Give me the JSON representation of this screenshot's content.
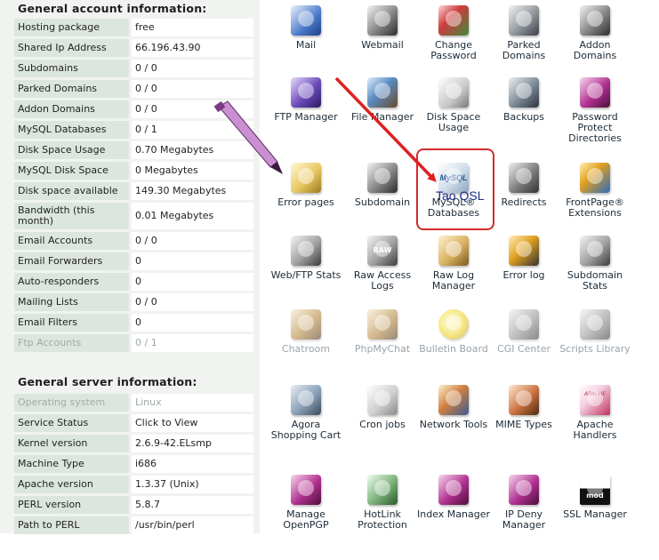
{
  "account_section": {
    "title": "General account information:",
    "rows": [
      {
        "label": "Hosting package",
        "value": "free"
      },
      {
        "label": "Shared Ip Address",
        "value": "66.196.43.90"
      },
      {
        "label": "Subdomains",
        "value": "0 / 0"
      },
      {
        "label": "Parked Domains",
        "value": "0 / 0"
      },
      {
        "label": "Addon Domains",
        "value": "0 / 0"
      },
      {
        "label": "MySQL Databases",
        "value": "0 / 1"
      },
      {
        "label": "Disk Space Usage",
        "value": "0.70 Megabytes"
      },
      {
        "label": "MySQL Disk Space",
        "value": "0 Megabytes"
      },
      {
        "label": "Disk space available",
        "value": "149.30 Megabytes"
      },
      {
        "label": "Bandwidth (this month)",
        "value": "0.01 Megabytes"
      },
      {
        "label": "Email Accounts",
        "value": "0 / 0"
      },
      {
        "label": "Email Forwarders",
        "value": "0"
      },
      {
        "label": "Auto-responders",
        "value": "0"
      },
      {
        "label": "Mailing Lists",
        "value": "0 / 0"
      },
      {
        "label": "Email Filters",
        "value": "0"
      },
      {
        "label": "Ftp Accounts",
        "value": "0 / 1"
      }
    ]
  },
  "server_section": {
    "title": "General server information:",
    "rows": [
      {
        "label": "Operating system",
        "value": "Linux"
      },
      {
        "label": "Service Status",
        "value": "Click to View"
      },
      {
        "label": "Kernel version",
        "value": "2.6.9-42.ELsmp"
      },
      {
        "label": "Machine Type",
        "value": "i686"
      },
      {
        "label": "Apache version",
        "value": "1.3.37 (Unix)"
      },
      {
        "label": "PERL version",
        "value": "5.8.7"
      },
      {
        "label": "Path to PERL",
        "value": "/usr/bin/perl"
      }
    ]
  },
  "icons": [
    {
      "label": "Mail",
      "icon": "mail-icon"
    },
    {
      "label": "Webmail",
      "icon": "webmail-icon"
    },
    {
      "label": "Change Password",
      "icon": "change-password-icon"
    },
    {
      "label": "Parked Domains",
      "icon": "parked-domains-icon"
    },
    {
      "label": "Addon Domains",
      "icon": "addon-domains-icon"
    },
    {
      "label": "FTP Manager",
      "icon": "ftp-manager-icon"
    },
    {
      "label": "File Manager",
      "icon": "file-manager-icon"
    },
    {
      "label": "Disk Space Usage",
      "icon": "disk-space-icon"
    },
    {
      "label": "Backups",
      "icon": "backups-icon"
    },
    {
      "label": "Password Protect Directories",
      "icon": "password-protect-icon"
    },
    {
      "label": "Error pages",
      "icon": "error-pages-icon"
    },
    {
      "label": "Subdomain",
      "icon": "subdomain-icon"
    },
    {
      "label": "MySQL® Databases",
      "icon": "mysql-icon"
    },
    {
      "label": "Redirects",
      "icon": "redirects-icon"
    },
    {
      "label": "FrontPage® Extensions",
      "icon": "frontpage-icon"
    },
    {
      "label": "Web/FTP Stats",
      "icon": "web-ftp-stats-icon"
    },
    {
      "label": "Raw Access Logs",
      "icon": "raw-access-logs-icon"
    },
    {
      "label": "Raw Log Manager",
      "icon": "raw-log-manager-icon"
    },
    {
      "label": "Error log",
      "icon": "error-log-icon"
    },
    {
      "label": "Subdomain Stats",
      "icon": "subdomain-stats-icon"
    },
    {
      "label": "Chatroom",
      "icon": "chatroom-icon"
    },
    {
      "label": "PhpMyChat",
      "icon": "phpmychat-icon"
    },
    {
      "label": "Bulletin Board",
      "icon": "bulletin-board-icon"
    },
    {
      "label": "CGI Center",
      "icon": "cgi-center-icon"
    },
    {
      "label": "Scripts Library",
      "icon": "scripts-library-icon"
    },
    {
      "label": "Agora Shopping Cart",
      "icon": "shopping-cart-icon"
    },
    {
      "label": "Cron jobs",
      "icon": "cron-jobs-icon"
    },
    {
      "label": "Network Tools",
      "icon": "network-tools-icon"
    },
    {
      "label": "MIME Types",
      "icon": "mime-types-icon"
    },
    {
      "label": "Apache Handlers",
      "icon": "apache-handlers-icon"
    },
    {
      "label": "Manage OpenPGP",
      "icon": "openpgp-icon"
    },
    {
      "label": "HotLink Protection",
      "icon": "hotlink-icon"
    },
    {
      "label": "Index Manager",
      "icon": "index-manager-icon"
    },
    {
      "label": "IP Deny Manager",
      "icon": "ip-deny-icon"
    },
    {
      "label": "SSL Manager",
      "icon": "ssl-manager-icon"
    }
  ],
  "icon_art": {
    "mysql_logo": "MySQL",
    "raw_badge": "RAW",
    "apache_logo": "APACHE",
    "ssl_logo": "mod SSL"
  },
  "annotation": {
    "callout_text": "Tao QSL",
    "arrow_color": "#e02020",
    "box_color": "#d42a2a",
    "callout_color": "#1a2f8a"
  },
  "theme": {
    "label_bg": "#dde6de",
    "panel_bg": "#f1f3f1",
    "muted_text": "#a3aaa5"
  }
}
